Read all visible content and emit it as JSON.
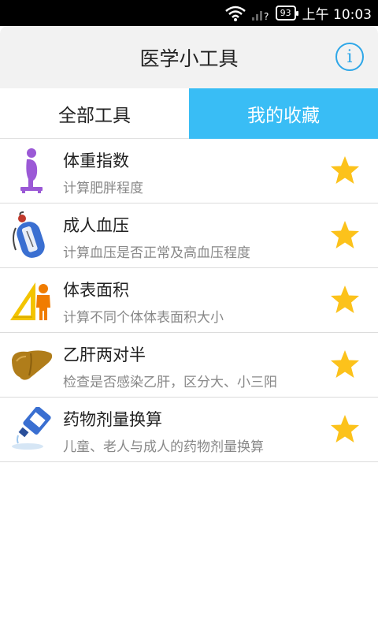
{
  "status_bar": {
    "battery": "93",
    "time": "上午 10:03"
  },
  "header": {
    "title": "医学小工具",
    "info_icon": "info-icon"
  },
  "tabs": [
    {
      "label": "全部工具",
      "selected": false
    },
    {
      "label": "我的收藏",
      "selected": true
    }
  ],
  "colors": {
    "accent": "#39bdf5",
    "star": "#fcc21b"
  },
  "items": [
    {
      "title": "体重指数",
      "subtitle": "计算肥胖程度",
      "icon": "body-scale-icon",
      "favorited": true
    },
    {
      "title": "成人血压",
      "subtitle": "计算血压是否正常及高血压程度",
      "icon": "blood-pressure-icon",
      "favorited": true
    },
    {
      "title": "体表面积",
      "subtitle": "计算不同个体体表面积大小",
      "icon": "body-surface-icon",
      "favorited": true
    },
    {
      "title": "乙肝两对半",
      "subtitle": "检查是否感染乙肝，区分大、小三阳",
      "icon": "liver-icon",
      "favorited": true
    },
    {
      "title": "药物剂量换算",
      "subtitle": "儿童、老人与成人的药物剂量换算",
      "icon": "medicine-bottle-icon",
      "favorited": true
    }
  ]
}
